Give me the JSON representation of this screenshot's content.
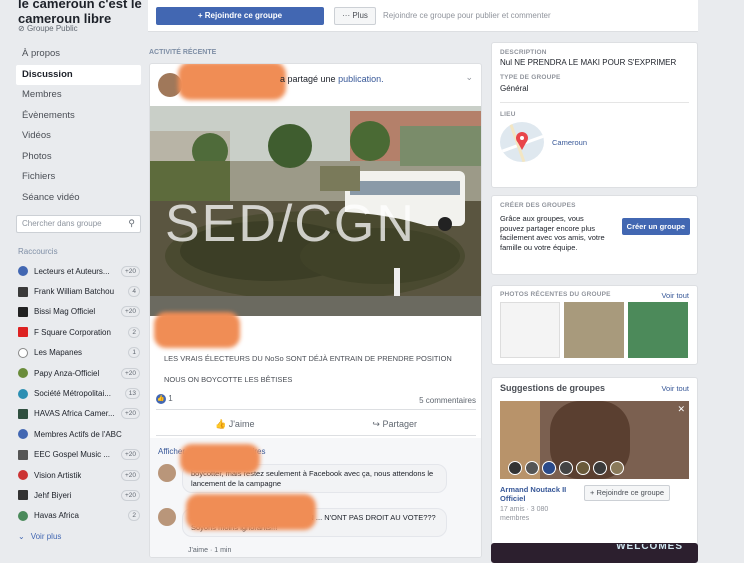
{
  "group": {
    "title": "le cameroun c'est le cameroun libre",
    "privacy": "Groupe Public"
  },
  "nav": [
    "À propos",
    "Discussion",
    "Membres",
    "Évènements",
    "Vidéos",
    "Photos",
    "Fichiers",
    "Séance vidéo"
  ],
  "search": {
    "placeholder": "Chercher dans groupe"
  },
  "shortcuts": {
    "header": "Raccourcis",
    "items": [
      {
        "label": "Lecteurs et Auteurs...",
        "count": "+20"
      },
      {
        "label": "Frank William Batchou",
        "count": "4"
      },
      {
        "label": "Bissi Mag Officiel",
        "count": "+20"
      },
      {
        "label": "F Square Corporation",
        "count": "2"
      },
      {
        "label": "Les Mapanes",
        "count": "1"
      },
      {
        "label": "Papy Anza-Officiel",
        "count": "+20"
      },
      {
        "label": "Société Métropolitai...",
        "count": "13"
      },
      {
        "label": "HAVAS Africa Camer...",
        "count": "+20"
      },
      {
        "label": "Membres Actifs de l'ABC",
        "count": ""
      },
      {
        "label": "EEC Gospel Music ...",
        "count": "+20"
      },
      {
        "label": "Vision Artistik",
        "count": "+20"
      },
      {
        "label": "Jehf Biyeri",
        "count": "+20"
      },
      {
        "label": "Havas Africa",
        "count": "2"
      }
    ],
    "see_more": "Voir plus"
  },
  "topbar": {
    "join": "+ Rejoindre ce groupe",
    "more": "··· Plus",
    "hint": "Rejoindre ce groupe pour publier et commenter"
  },
  "feed": {
    "header": "ACTIVITÉ RÉCENTE",
    "post": {
      "shared": "a partagé une",
      "link": "publication.",
      "watermark": "SED/CGN",
      "text1": "LES VRAIS ÉLECTEURS DU NoSo SONT DÉJÀ ENTRAIN DE PRENDRE POSITION",
      "text2": "NOUS ON BOYCOTTE LES BÊTISES",
      "likes": "1",
      "comments_count": "5 commentaires",
      "like_action": "J'aime",
      "share_action": "Partager"
    },
    "comments": {
      "show_more": "Afficher plus de commentaires",
      "c1": "boycotter, mais restez seulement à Facebook avec ça, nous attendons le lancement de la campagne",
      "c2": "QUI T'A DIT QUE LES HOMMES EN ... N'ONT PAS DROIT AU VOTE??? Soyons moins ignorants!!!",
      "meta": "J'aime · 1 min"
    }
  },
  "about": {
    "desc_label": "DESCRIPTION",
    "desc": "Nul NE PRENDRA LE MAKI POUR S'EXPRIMER",
    "type_label": "TYPE DE GROUPE",
    "type": "Général",
    "place_label": "LIEU",
    "place": "Cameroun"
  },
  "create": {
    "header": "CRÉER DES GROUPES",
    "text": "Grâce aux groupes, vous pouvez partager encore plus facilement avec vos amis, votre famille ou votre équipe.",
    "button": "Créer un groupe"
  },
  "photos": {
    "header": "PHOTOS RÉCENTES DU GROUPE",
    "see_all": "Voir tout"
  },
  "suggest": {
    "header": "Suggestions de groupes",
    "see_all": "Voir tout",
    "name": "Armand Noutack II Officiel",
    "meta": "17 amis · 3 080 membres",
    "join": "+ Rejoindre ce groupe",
    "banner": "WELCOMES"
  }
}
